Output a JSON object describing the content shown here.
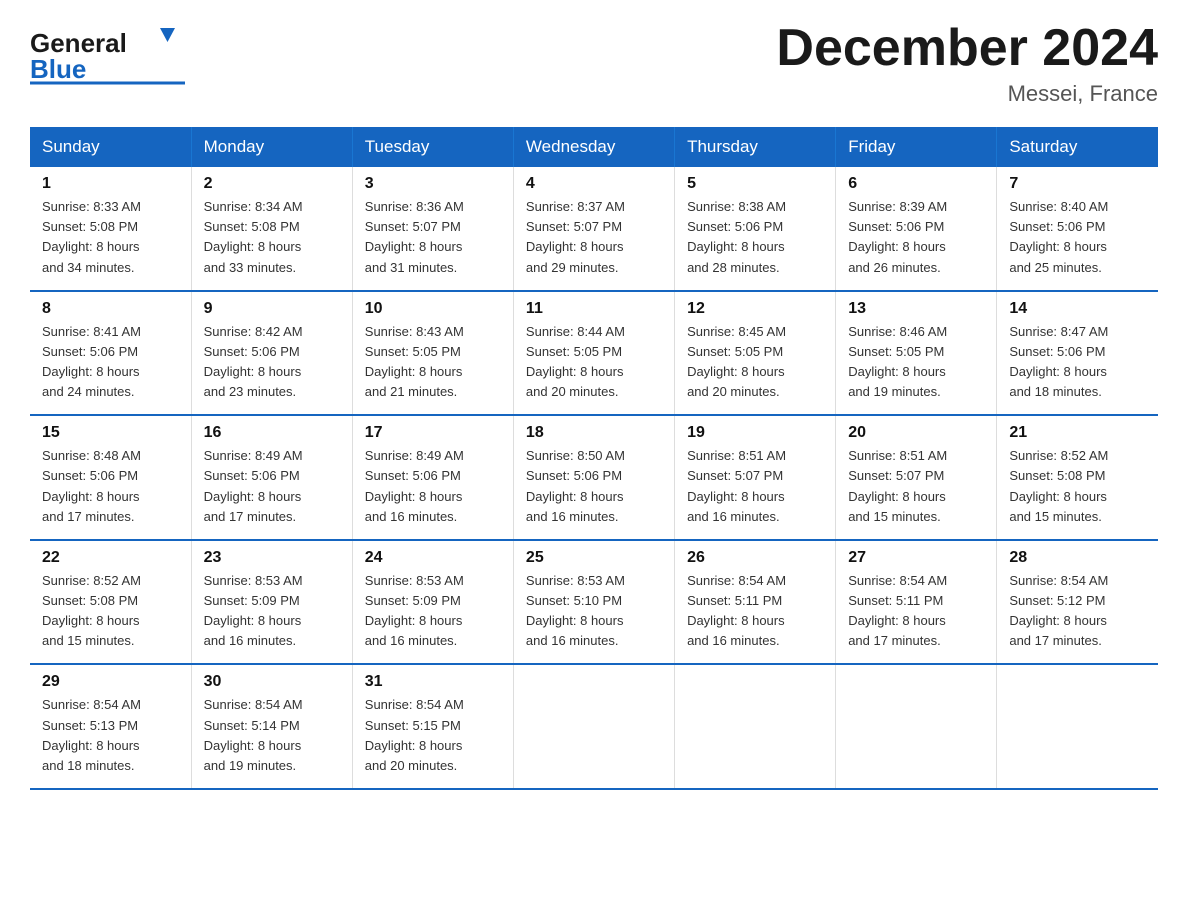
{
  "header": {
    "logo": {
      "general": "General",
      "blue": "Blue"
    },
    "title": "December 2024",
    "location": "Messei, France"
  },
  "calendar": {
    "days": [
      "Sunday",
      "Monday",
      "Tuesday",
      "Wednesday",
      "Thursday",
      "Friday",
      "Saturday"
    ],
    "weeks": [
      [
        {
          "day": "1",
          "sunrise": "8:33 AM",
          "sunset": "5:08 PM",
          "daylight": "8 hours and 34 minutes."
        },
        {
          "day": "2",
          "sunrise": "8:34 AM",
          "sunset": "5:08 PM",
          "daylight": "8 hours and 33 minutes."
        },
        {
          "day": "3",
          "sunrise": "8:36 AM",
          "sunset": "5:07 PM",
          "daylight": "8 hours and 31 minutes."
        },
        {
          "day": "4",
          "sunrise": "8:37 AM",
          "sunset": "5:07 PM",
          "daylight": "8 hours and 29 minutes."
        },
        {
          "day": "5",
          "sunrise": "8:38 AM",
          "sunset": "5:06 PM",
          "daylight": "8 hours and 28 minutes."
        },
        {
          "day": "6",
          "sunrise": "8:39 AM",
          "sunset": "5:06 PM",
          "daylight": "8 hours and 26 minutes."
        },
        {
          "day": "7",
          "sunrise": "8:40 AM",
          "sunset": "5:06 PM",
          "daylight": "8 hours and 25 minutes."
        }
      ],
      [
        {
          "day": "8",
          "sunrise": "8:41 AM",
          "sunset": "5:06 PM",
          "daylight": "8 hours and 24 minutes."
        },
        {
          "day": "9",
          "sunrise": "8:42 AM",
          "sunset": "5:06 PM",
          "daylight": "8 hours and 23 minutes."
        },
        {
          "day": "10",
          "sunrise": "8:43 AM",
          "sunset": "5:05 PM",
          "daylight": "8 hours and 21 minutes."
        },
        {
          "day": "11",
          "sunrise": "8:44 AM",
          "sunset": "5:05 PM",
          "daylight": "8 hours and 20 minutes."
        },
        {
          "day": "12",
          "sunrise": "8:45 AM",
          "sunset": "5:05 PM",
          "daylight": "8 hours and 20 minutes."
        },
        {
          "day": "13",
          "sunrise": "8:46 AM",
          "sunset": "5:05 PM",
          "daylight": "8 hours and 19 minutes."
        },
        {
          "day": "14",
          "sunrise": "8:47 AM",
          "sunset": "5:06 PM",
          "daylight": "8 hours and 18 minutes."
        }
      ],
      [
        {
          "day": "15",
          "sunrise": "8:48 AM",
          "sunset": "5:06 PM",
          "daylight": "8 hours and 17 minutes."
        },
        {
          "day": "16",
          "sunrise": "8:49 AM",
          "sunset": "5:06 PM",
          "daylight": "8 hours and 17 minutes."
        },
        {
          "day": "17",
          "sunrise": "8:49 AM",
          "sunset": "5:06 PM",
          "daylight": "8 hours and 16 minutes."
        },
        {
          "day": "18",
          "sunrise": "8:50 AM",
          "sunset": "5:06 PM",
          "daylight": "8 hours and 16 minutes."
        },
        {
          "day": "19",
          "sunrise": "8:51 AM",
          "sunset": "5:07 PM",
          "daylight": "8 hours and 16 minutes."
        },
        {
          "day": "20",
          "sunrise": "8:51 AM",
          "sunset": "5:07 PM",
          "daylight": "8 hours and 15 minutes."
        },
        {
          "day": "21",
          "sunrise": "8:52 AM",
          "sunset": "5:08 PM",
          "daylight": "8 hours and 15 minutes."
        }
      ],
      [
        {
          "day": "22",
          "sunrise": "8:52 AM",
          "sunset": "5:08 PM",
          "daylight": "8 hours and 15 minutes."
        },
        {
          "day": "23",
          "sunrise": "8:53 AM",
          "sunset": "5:09 PM",
          "daylight": "8 hours and 16 minutes."
        },
        {
          "day": "24",
          "sunrise": "8:53 AM",
          "sunset": "5:09 PM",
          "daylight": "8 hours and 16 minutes."
        },
        {
          "day": "25",
          "sunrise": "8:53 AM",
          "sunset": "5:10 PM",
          "daylight": "8 hours and 16 minutes."
        },
        {
          "day": "26",
          "sunrise": "8:54 AM",
          "sunset": "5:11 PM",
          "daylight": "8 hours and 16 minutes."
        },
        {
          "day": "27",
          "sunrise": "8:54 AM",
          "sunset": "5:11 PM",
          "daylight": "8 hours and 17 minutes."
        },
        {
          "day": "28",
          "sunrise": "8:54 AM",
          "sunset": "5:12 PM",
          "daylight": "8 hours and 17 minutes."
        }
      ],
      [
        {
          "day": "29",
          "sunrise": "8:54 AM",
          "sunset": "5:13 PM",
          "daylight": "8 hours and 18 minutes."
        },
        {
          "day": "30",
          "sunrise": "8:54 AM",
          "sunset": "5:14 PM",
          "daylight": "8 hours and 19 minutes."
        },
        {
          "day": "31",
          "sunrise": "8:54 AM",
          "sunset": "5:15 PM",
          "daylight": "8 hours and 20 minutes."
        },
        null,
        null,
        null,
        null
      ]
    ],
    "labels": {
      "sunrise": "Sunrise:",
      "sunset": "Sunset:",
      "daylight": "Daylight:"
    }
  }
}
